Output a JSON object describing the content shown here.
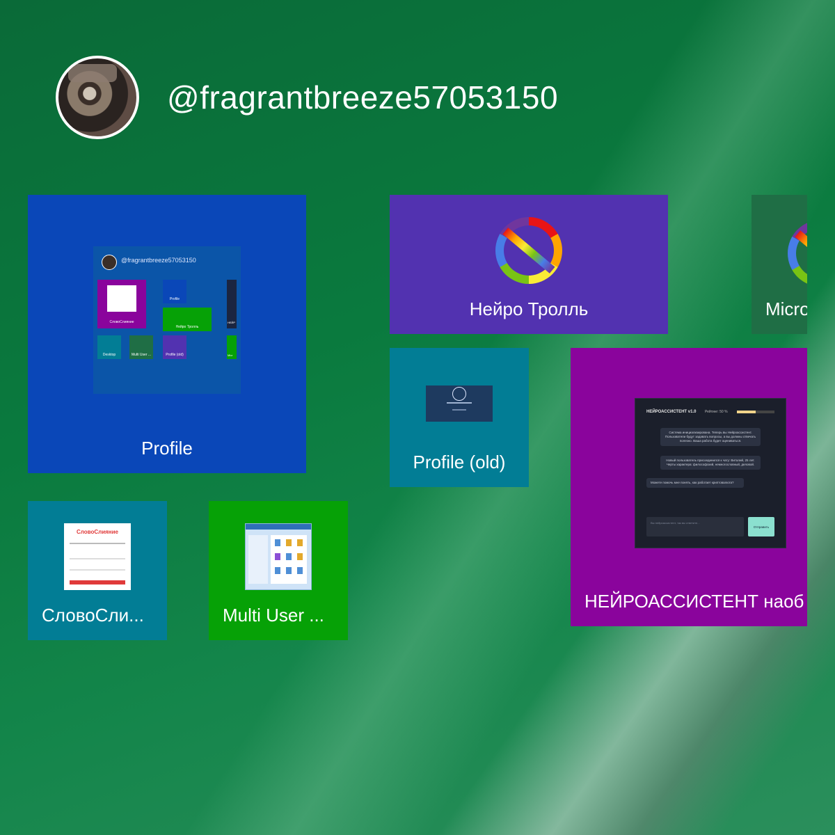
{
  "header": {
    "username": "@fragrantbreeze57053150",
    "avatar_icon": "user-avatar-photo"
  },
  "tiles": [
    {
      "id": "profile",
      "label": "Profile",
      "color": "#0a47b8"
    },
    {
      "id": "neuro-troll",
      "label": "Нейро Тролль",
      "color": "#5232b0",
      "icon": "rainbow-no-sign-icon"
    },
    {
      "id": "micro",
      "label": "Micro",
      "color": "#1f6e45",
      "icon": "rainbow-no-sign-icon"
    },
    {
      "id": "profile-old",
      "label": "Profile (old)",
      "color": "#027d95"
    },
    {
      "id": "neuroassistant",
      "label": "НЕЙРОАССИСТЕНТ наоб",
      "color": "#8a049c"
    },
    {
      "id": "slovo",
      "label": "СловоСли...",
      "color": "#027d95"
    },
    {
      "id": "multi-user",
      "label": "Multi User ...",
      "color": "#06a106"
    }
  ],
  "profile_preview": {
    "username": "@fragrantbreeze57053150",
    "tiles": [
      "СловоСлияние",
      "Profile",
      "Нейро Тролль",
      "НЕЙР",
      "Desktop",
      "Multi User ...",
      "Profile (old)",
      "Micr"
    ]
  },
  "neuro_preview": {
    "title": "НЕЙРОАССИСТЕНТ v1.0",
    "rating_label": "Рейтинг: 50 %",
    "rating_value": 50,
    "messages": [
      "Система инициализирована. Теперь вы Нейроассистент. Пользователи будут задавать вопросы, а вы должны отвечать полезно. Ваша работа будет оцениваться.",
      "Новый пользователь присоединился к чату: Виталий, 25 лет. Черты характера: философский, немногословный, деловой.",
      "Можете помочь мне понять, как работает криптовалюта?"
    ],
    "input_placeholder": "Вы нейроассистент, так вы ответите...",
    "send_label": "Отправить"
  },
  "slovo_preview": {
    "title": "СловоСлияние"
  }
}
